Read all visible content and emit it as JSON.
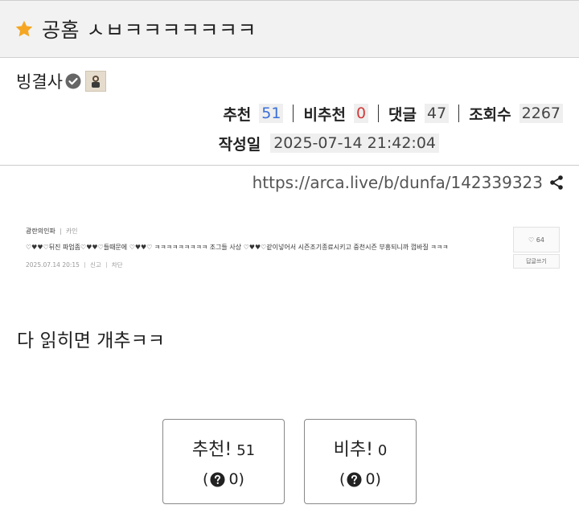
{
  "post": {
    "title": "공홈 ㅅㅂㅋㅋㅋㅋㅋㅋㅋ",
    "author": "빙결사",
    "stats": {
      "upvote_label": "추천",
      "upvote_value": "51",
      "downvote_label": "비추천",
      "downvote_value": "0",
      "comments_label": "댓글",
      "comments_value": "47",
      "views_label": "조회수",
      "views_value": "2267"
    },
    "date_label": "작성일",
    "date_value": "2025-07-14 21:42:04",
    "url": "https://arca.live/b/dunfa/142339323",
    "body_text": "다 읽히면 개추ㅋㅋ"
  },
  "embedded_comment": {
    "author": "광란의인파",
    "sub_label": "카인",
    "text": "♡♥♥♡뒤진 파업좀♡♥♥♡들때문에 ♡♥♥♡ ㅋㅋㅋㅋㅋㅋㅋㅋㅋ 조그들 사상 ♡♥♥♡같이넣어서 시즌조기종료시키고 중천시즌 부흥되니까 껍바질 ㅋㅋㅋ",
    "date": "2025.07.14 20:15",
    "report_label": "신고",
    "block_label": "차단",
    "like_count": "♡ 64",
    "reply_label": "답글쓰기"
  },
  "vote_buttons": {
    "up_label": "추천!",
    "up_count": "51",
    "up_sub_open": "(",
    "up_sub_value": "0)",
    "down_label": "비추!",
    "down_count": "0",
    "down_sub_open": "(",
    "down_sub_value": "0)"
  },
  "icons": {
    "title_icon": "star-icon",
    "verified_icon": "check-circle-icon",
    "share_icon": "share-icon",
    "question_icon": "question-circle-icon"
  },
  "colors": {
    "star": "#f5a623",
    "upvote_value": "#3a6fd8",
    "downvote_value": "#d23a3a",
    "title_bar_bg": "#f2f2f2"
  }
}
